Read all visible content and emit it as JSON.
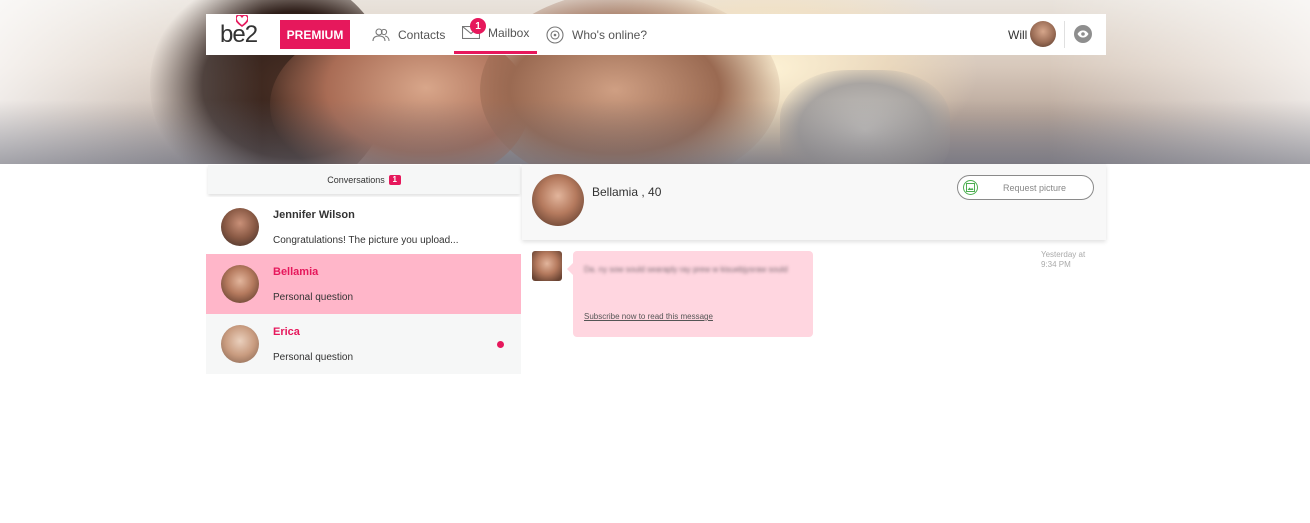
{
  "brand": {
    "logo_text": "be2",
    "accent_color": "#e6185c"
  },
  "nav": {
    "premium_label": "PREMIUM",
    "items": [
      {
        "label": "Contacts",
        "icon": "contacts-icon"
      },
      {
        "label": "Mailbox",
        "icon": "mail-icon",
        "badge": "1",
        "active": true
      },
      {
        "label": "Who's online?",
        "icon": "online-target-icon"
      }
    ],
    "user_name": "Will",
    "visibility_icon": "eye-icon"
  },
  "sidebar": {
    "header_label": "Conversations",
    "header_badge": "1",
    "conversations": [
      {
        "name": "Jennifer Wilson",
        "preview": "Congratulations! The picture you upload..."
      },
      {
        "name": "Bellamia",
        "preview": "Personal question"
      },
      {
        "name": "Erica",
        "preview": "Personal question",
        "unread": true
      }
    ]
  },
  "chat": {
    "title": "Bellamia , 40",
    "request_picture_label": "Request picture",
    "message": {
      "blurred_text": "Da. ny sow sould searaply ray prew w kisuebjysraw sould",
      "subscribe_link": "Subscribe now to read this message",
      "timestamp": "Yesterday at 9:34 PM"
    }
  }
}
